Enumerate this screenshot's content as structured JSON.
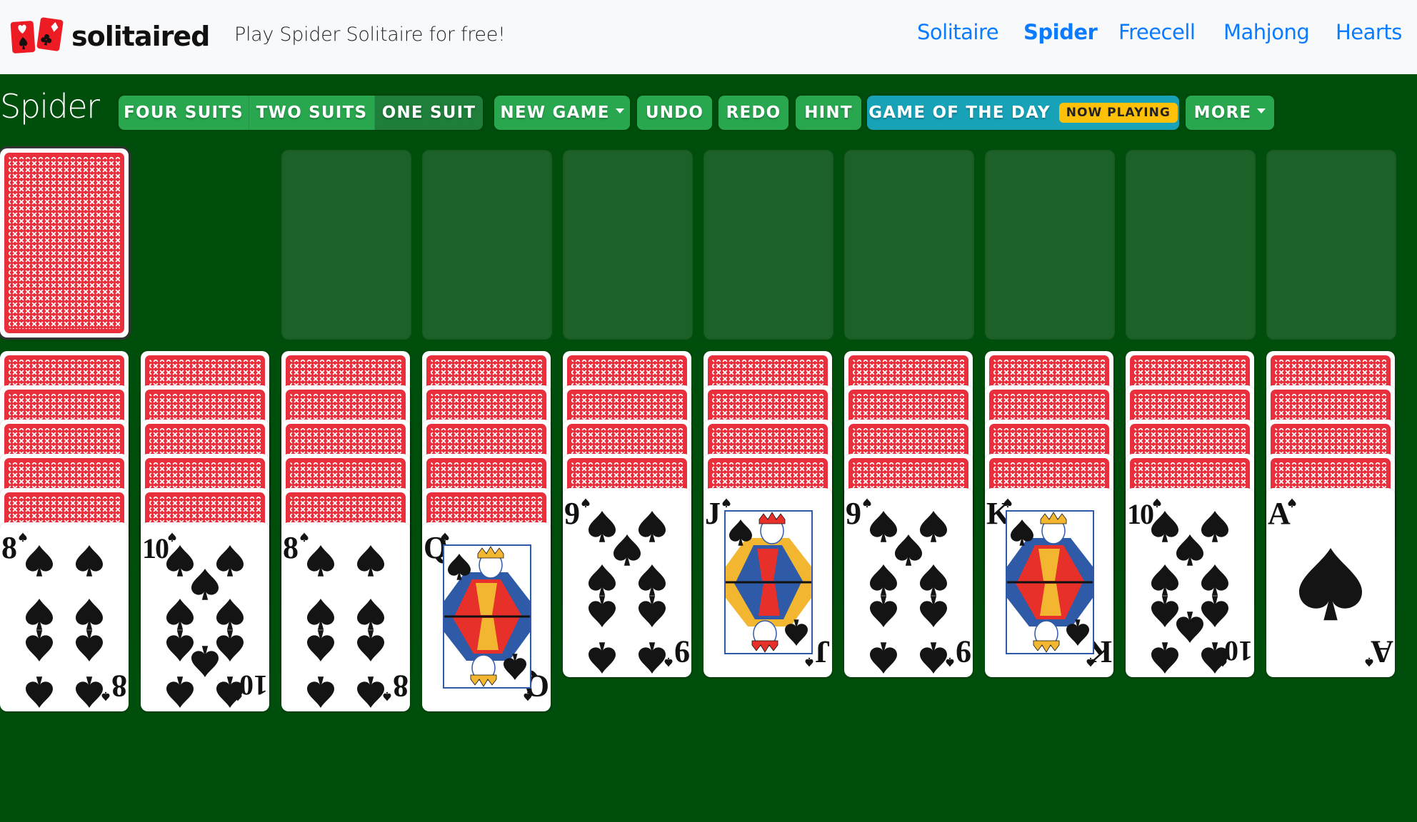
{
  "header": {
    "logo_text": "solitaired",
    "tagline": "Play Spider Solitaire for free!",
    "nav": [
      {
        "label": "Solitaire",
        "active": false
      },
      {
        "label": "Spider",
        "active": true
      },
      {
        "label": "Freecell",
        "active": false
      },
      {
        "label": "Mahjong",
        "active": false
      },
      {
        "label": "Hearts",
        "active": false
      }
    ]
  },
  "toolbar": {
    "title": "Spider",
    "suit_modes": [
      {
        "label": "FOUR SUITS",
        "active": false
      },
      {
        "label": "TWO SUITS",
        "active": false
      },
      {
        "label": "ONE SUIT",
        "active": true
      }
    ],
    "new_game_label": "NEW GAME",
    "undo_label": "UNDO",
    "redo_label": "REDO",
    "hint_label": "HINT",
    "game_of_day_label": "GAME OF THE DAY",
    "game_of_day_badge": "NOW PLAYING",
    "more_label": "MORE"
  },
  "colors": {
    "felt": "#004e0c",
    "button_green": "#28a74f",
    "button_active": "#1e7e3a",
    "game_of_day": "#17a2b8",
    "badge": "#ffc107",
    "nav_link": "#0b7bff",
    "card_back_red": "#ea2f3c"
  },
  "board": {
    "stock": {
      "face_down": true
    },
    "foundations": [
      {
        "cards": 0
      },
      {
        "cards": 0
      },
      {
        "cards": 0
      },
      {
        "cards": 0
      },
      {
        "cards": 0
      },
      {
        "cards": 0
      },
      {
        "cards": 0
      },
      {
        "cards": 0
      }
    ],
    "tableau": [
      {
        "face_down": 5,
        "face_up": [
          {
            "rank": "8",
            "suit": "spades"
          }
        ]
      },
      {
        "face_down": 5,
        "face_up": [
          {
            "rank": "10",
            "suit": "spades"
          }
        ]
      },
      {
        "face_down": 5,
        "face_up": [
          {
            "rank": "8",
            "suit": "spades"
          }
        ]
      },
      {
        "face_down": 5,
        "face_up": [
          {
            "rank": "Q",
            "suit": "spades"
          }
        ]
      },
      {
        "face_down": 4,
        "face_up": [
          {
            "rank": "9",
            "suit": "spades"
          }
        ]
      },
      {
        "face_down": 4,
        "face_up": [
          {
            "rank": "J",
            "suit": "spades"
          }
        ]
      },
      {
        "face_down": 4,
        "face_up": [
          {
            "rank": "9",
            "suit": "spades"
          }
        ]
      },
      {
        "face_down": 4,
        "face_up": [
          {
            "rank": "K",
            "suit": "spades"
          }
        ]
      },
      {
        "face_down": 4,
        "face_up": [
          {
            "rank": "10",
            "suit": "spades"
          }
        ]
      },
      {
        "face_down": 4,
        "face_up": [
          {
            "rank": "A",
            "suit": "spades"
          }
        ]
      }
    ]
  }
}
